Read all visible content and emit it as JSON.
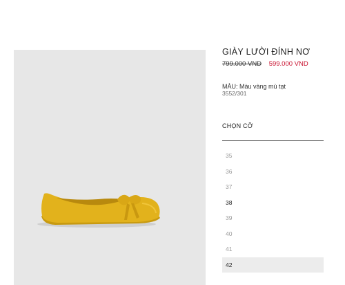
{
  "product": {
    "name": "GIÀY LƯỜI ĐÍNH NƠ",
    "old_price": "799.000 VND",
    "new_price": "599.000 VND",
    "color_label": "MÀU: Màu vàng mù tạt",
    "reference": "3552/301",
    "image_alt": "yellow-suede-bow-loafer"
  },
  "sizes": {
    "heading": "CHỌN CỠ",
    "items": [
      {
        "label": "35",
        "available": false,
        "selected": false
      },
      {
        "label": "36",
        "available": false,
        "selected": false
      },
      {
        "label": "37",
        "available": false,
        "selected": false
      },
      {
        "label": "38",
        "available": true,
        "selected": false
      },
      {
        "label": "39",
        "available": false,
        "selected": false
      },
      {
        "label": "40",
        "available": false,
        "selected": false
      },
      {
        "label": "41",
        "available": false,
        "selected": false
      },
      {
        "label": "42",
        "available": true,
        "selected": true
      }
    ]
  },
  "colors": {
    "accent_price": "#c8102e",
    "shoe": "#e2b21c",
    "image_bg": "#e7e7e7"
  }
}
